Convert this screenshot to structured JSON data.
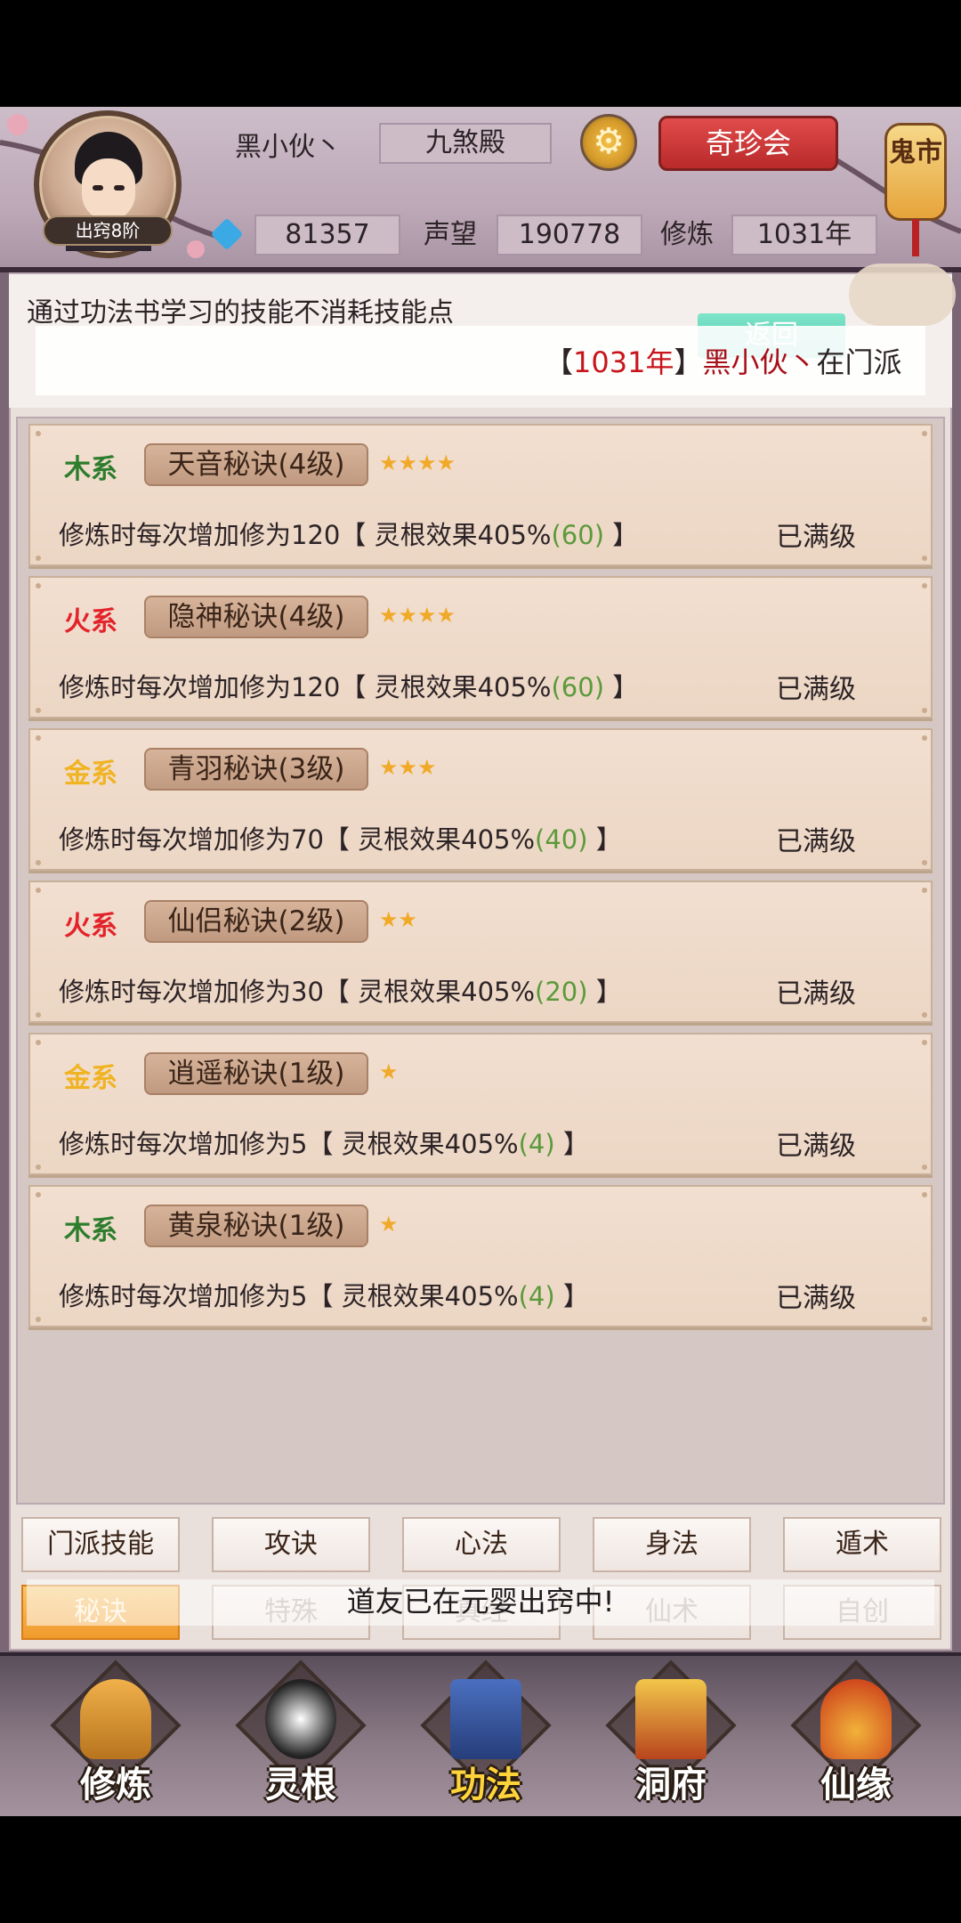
{
  "header": {
    "rank": "出窍8阶",
    "name": "黑小伙丶",
    "sect": "九煞殿",
    "settings_icon": "gear-icon",
    "treasure_button": "奇珍会",
    "ghost_market": "鬼市",
    "spirit_stones": "81357",
    "prestige_label": "声望",
    "prestige_value": "190778",
    "cultivation_label": "修炼",
    "cultivation_value": "1031年"
  },
  "info": {
    "note": "通过功法书学习的技能不消耗技能点",
    "return_button": "返回",
    "marquee_open": "【",
    "marquee_year": "1031年",
    "marquee_close": "】",
    "marquee_name": "黑小伙丶",
    "marquee_rest": "在门派"
  },
  "skills": [
    {
      "element": "木系",
      "element_color": "#2d7d2d",
      "name": "天音秘诀(4级)",
      "stars": 4,
      "stars_text": "★★★★",
      "desc_prefix": "修炼时每次增加修为120【 灵根效果405%",
      "desc_bonus": "(60)",
      "desc_suffix": " 】",
      "status": "已满级"
    },
    {
      "element": "火系",
      "element_color": "#e3232a",
      "name": "隐神秘诀(4级)",
      "stars": 4,
      "stars_text": "★★★★",
      "desc_prefix": "修炼时每次增加修为120【 灵根效果405%",
      "desc_bonus": "(60)",
      "desc_suffix": " 】",
      "status": "已满级"
    },
    {
      "element": "金系",
      "element_color": "#f0b322",
      "name": "青羽秘诀(3级)",
      "stars": 3,
      "stars_text": "★★★",
      "desc_prefix": "修炼时每次增加修为70【 灵根效果405%",
      "desc_bonus": "(40)",
      "desc_suffix": " 】",
      "status": "已满级"
    },
    {
      "element": "火系",
      "element_color": "#e3232a",
      "name": "仙侣秘诀(2级)",
      "stars": 2,
      "stars_text": "★★",
      "desc_prefix": "修炼时每次增加修为30【 灵根效果405%",
      "desc_bonus": "(20)",
      "desc_suffix": " 】",
      "status": "已满级"
    },
    {
      "element": "金系",
      "element_color": "#f0b322",
      "name": "逍遥秘诀(1级)",
      "stars": 1,
      "stars_text": "★",
      "desc_prefix": "修炼时每次增加修为5【 灵根效果405%",
      "desc_bonus": "(4)",
      "desc_suffix": " 】",
      "status": "已满级"
    },
    {
      "element": "木系",
      "element_color": "#2d7d2d",
      "name": "黄泉秘诀(1级)",
      "stars": 1,
      "stars_text": "★",
      "desc_prefix": "修炼时每次增加修为5【 灵根效果405%",
      "desc_bonus": "(4)",
      "desc_suffix": " 】",
      "status": "已满级"
    }
  ],
  "tabs_row1": [
    "门派技能",
    "攻诀",
    "心法",
    "身法",
    "遁术"
  ],
  "tabs_row2": [
    "秘诀",
    "特殊",
    "真经",
    "仙术",
    "自创"
  ],
  "toast": "道友已在元婴出窍中!",
  "bottom_nav": [
    {
      "label": "修炼",
      "icon": "monk-icon",
      "active": false
    },
    {
      "label": "灵根",
      "icon": "sword-yinyang-icon",
      "active": false
    },
    {
      "label": "功法",
      "icon": "book-icon",
      "active": true
    },
    {
      "label": "洞府",
      "icon": "pavilion-icon",
      "active": false
    },
    {
      "label": "仙缘",
      "icon": "gourd-icon",
      "active": false
    }
  ],
  "colors": {
    "accent": "#f19a2a",
    "wood": "#2d7d2d",
    "fire": "#e3232a",
    "metal": "#f0b322",
    "bonus": "#5b9a3b"
  }
}
